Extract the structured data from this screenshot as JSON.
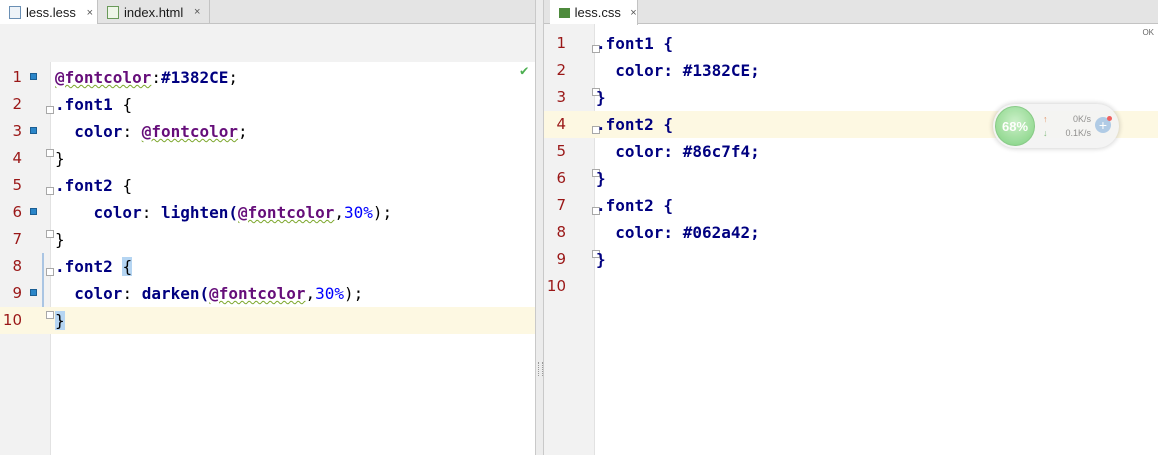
{
  "left_editor": {
    "tabs": [
      {
        "label": "less.less",
        "active": true
      },
      {
        "label": "index.html",
        "active": false
      }
    ],
    "lines": [
      {
        "n": "1",
        "tokens": [
          [
            "var",
            "@fontcolor"
          ],
          [
            "pun",
            ":"
          ],
          [
            "sel",
            "#1382CE"
          ],
          [
            "pun",
            ";"
          ]
        ]
      },
      {
        "n": "2",
        "tokens": [
          [
            "sel",
            ".font1 "
          ],
          [
            "brace",
            "{"
          ]
        ]
      },
      {
        "n": "3",
        "tokens": [
          [
            "sel",
            "  color"
          ],
          [
            "pun",
            ": "
          ],
          [
            "var",
            "@fontcolor"
          ],
          [
            "pun",
            ";"
          ]
        ]
      },
      {
        "n": "4",
        "tokens": [
          [
            "brace",
            "}"
          ]
        ]
      },
      {
        "n": "5",
        "tokens": [
          [
            "sel",
            ".font2 "
          ],
          [
            "brace",
            "{"
          ]
        ]
      },
      {
        "n": "6",
        "tokens": [
          [
            "sel",
            "    color"
          ],
          [
            "pun",
            ": "
          ],
          [
            "sel",
            "lighten("
          ],
          [
            "var",
            "@fontcolor"
          ],
          [
            "pun",
            ","
          ],
          [
            "num",
            "30%"
          ],
          [
            "pun",
            ");"
          ]
        ]
      },
      {
        "n": "7",
        "tokens": [
          [
            "brace",
            "}"
          ]
        ]
      },
      {
        "n": "8",
        "tokens": [
          [
            "sel",
            ".font2 "
          ],
          [
            "brace",
            "{"
          ]
        ]
      },
      {
        "n": "9",
        "tokens": [
          [
            "sel",
            "  color"
          ],
          [
            "pun",
            ": "
          ],
          [
            "sel",
            "darken("
          ],
          [
            "var",
            "@fontcolor"
          ],
          [
            "pun",
            ","
          ],
          [
            "num",
            "30%"
          ],
          [
            "pun",
            ");"
          ]
        ]
      },
      {
        "n": "10",
        "tokens": [
          [
            "brace",
            "}"
          ]
        ]
      }
    ]
  },
  "right_editor": {
    "tabs": [
      {
        "label": "less.css",
        "active": true
      }
    ],
    "lines": [
      {
        "n": "1",
        "text": ".font1 {"
      },
      {
        "n": "2",
        "text": "  color: #1382CE;"
      },
      {
        "n": "3",
        "text": "}"
      },
      {
        "n": "4",
        "text": ".font2 {"
      },
      {
        "n": "5",
        "text": "  color: #86c7f4;"
      },
      {
        "n": "6",
        "text": "}"
      },
      {
        "n": "7",
        "text": ".font2 {"
      },
      {
        "n": "8",
        "text": "  color: #062a42;"
      },
      {
        "n": "9",
        "text": "}"
      },
      {
        "n": "10",
        "text": ""
      }
    ],
    "corner_label": "OK"
  },
  "tab_close_glyph": "×",
  "net_widget": {
    "percent": "68%",
    "up_speed": "0K/s",
    "down_speed": "0.1K/s",
    "up_arrow": "↑",
    "down_arrow": "↓",
    "plus": "+"
  },
  "colors": {
    "line_number": "#9a1717",
    "selector": "#000080",
    "variable": "#660e7a",
    "number": "#0000ff",
    "current_line": "#fdf8e2",
    "marker": "#2b86c9"
  }
}
